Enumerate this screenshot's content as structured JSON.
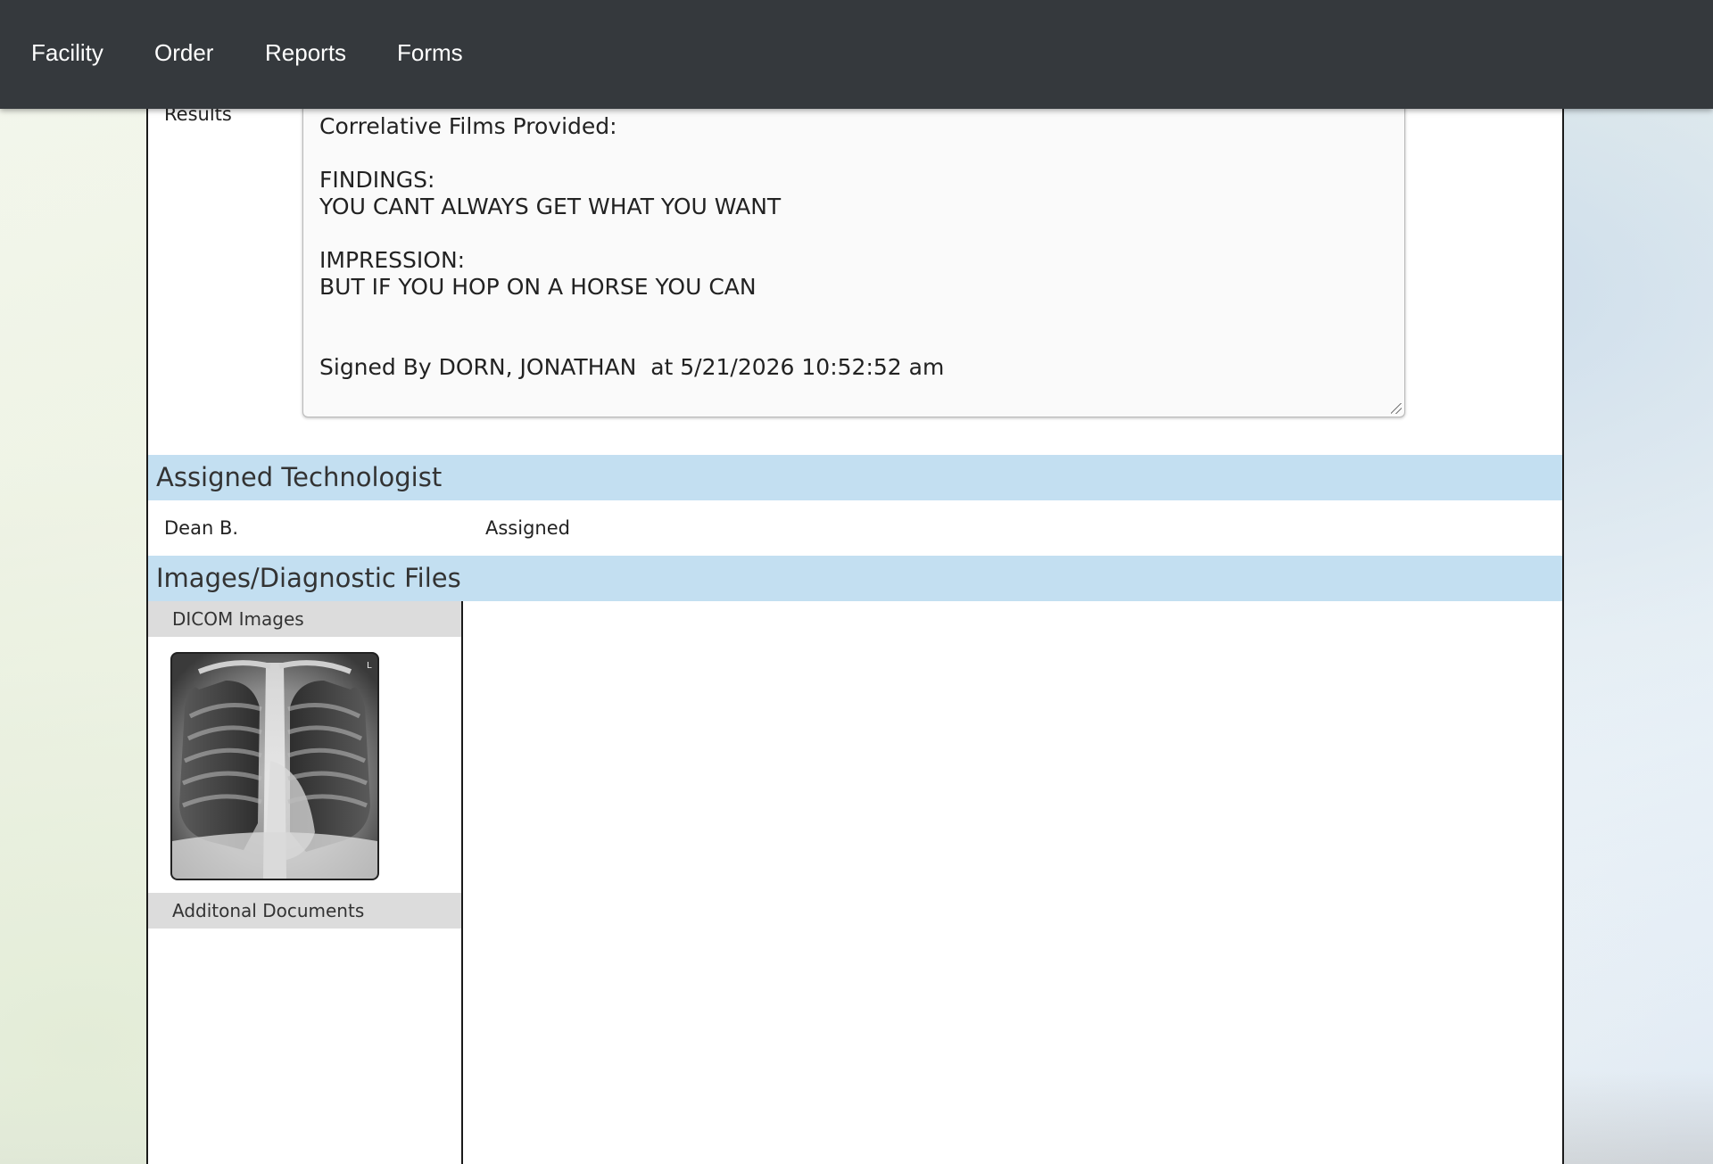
{
  "nav": {
    "items": [
      {
        "label": "Facility"
      },
      {
        "label": "Order"
      },
      {
        "label": "Reports"
      },
      {
        "label": "Forms"
      }
    ]
  },
  "results": {
    "label": "Results",
    "report_lines": [
      "Correlative Films Provided:",
      "",
      "FINDINGS:",
      "YOU CANT ALWAYS GET WHAT YOU WANT",
      "",
      "IMPRESSION:",
      "BUT IF YOU HOP ON A HORSE YOU CAN",
      "",
      "",
      "Signed By DORN, JONATHAN  at 5/21/2026 10:52:52 am"
    ]
  },
  "assigned_technologist": {
    "title": "Assigned Technologist",
    "name": "Dean  B.",
    "status": "Assigned"
  },
  "images_files": {
    "title": "Images/Diagnostic Files",
    "dicom_label": "DICOM Images",
    "thumbnail_marker": "L",
    "additional_label": "Additonal Documents"
  },
  "colors": {
    "navbar": "#35393d",
    "section_header": "#c3dff1",
    "subheader": "#dcdcdc"
  }
}
